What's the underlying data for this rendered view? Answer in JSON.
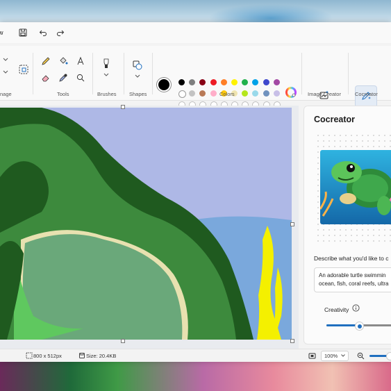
{
  "titlebar": {
    "partial_label": "w"
  },
  "ribbon": {
    "groups": {
      "image": "nage",
      "tools": "Tools",
      "brushes": "Brushes",
      "shapes": "Shapes",
      "colors": "Colors",
      "image_creator": "Image Creator",
      "cocreator": "Cocreator"
    },
    "palette_row1": [
      "#000000",
      "#7f7f7f",
      "#880015",
      "#ed1c24",
      "#ff7f27",
      "#fff200",
      "#22b14c",
      "#00a2e8",
      "#3f48cc",
      "#a349a4"
    ],
    "palette_row2": [
      "#ffffff",
      "#c3c3c3",
      "#b97a57",
      "#ffaec9",
      "#ffc90e",
      "#efe4b0",
      "#b5e61d",
      "#99d9ea",
      "#7092be",
      "#c8bfe7"
    ],
    "primary_color": "#000000",
    "secondary_color": "#ffffff"
  },
  "cocreator": {
    "title": "Cocreator",
    "describe_label": "Describe what you'd like to c",
    "prompt_text": "An adorable turtle swimmin\nocean, fish, coral reefs, ultra",
    "creativity_label": "Creativity",
    "creativity_level": 0.5
  },
  "status": {
    "dimensions": "800  x  512px",
    "size": "Size: 20.4KB",
    "zoom": "100%"
  },
  "colors": {
    "accent": "#1f6fbf"
  }
}
